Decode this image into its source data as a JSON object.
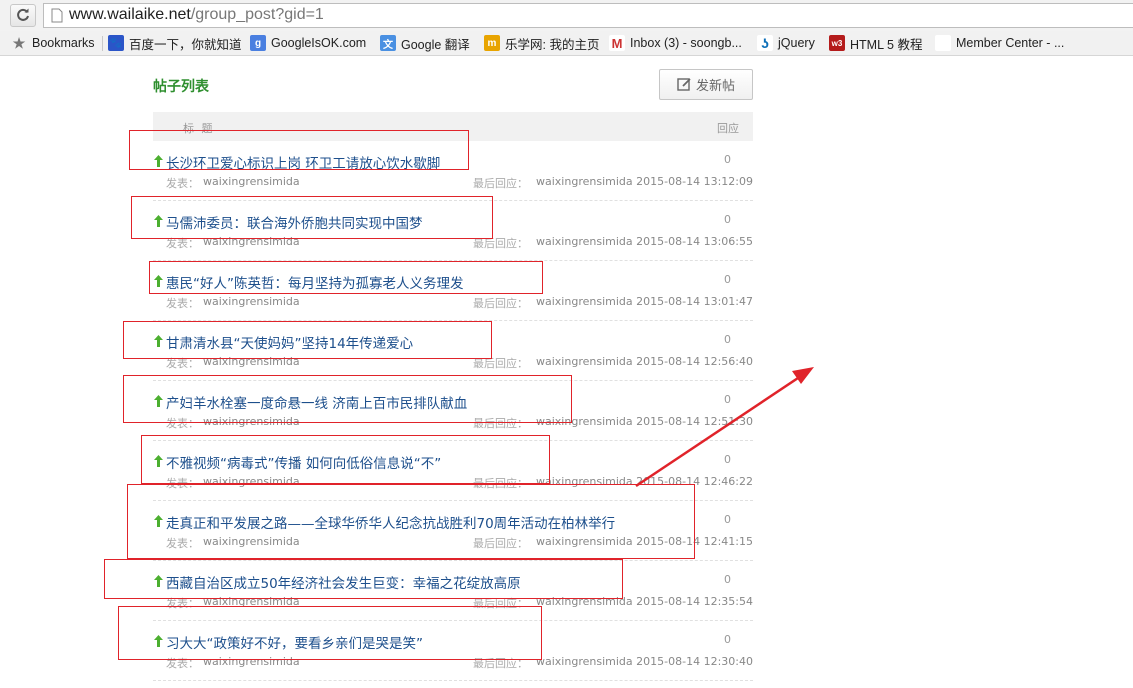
{
  "browser": {
    "url_domain": "www.wailaike.net",
    "url_path": "/group_post?gid=1",
    "bookmarks": [
      {
        "label": "Bookmarks",
        "icon": "star-icon"
      },
      {
        "label": "百度一下，你就知道",
        "icon": "baidu-paw-icon"
      },
      {
        "label": "GoogleIsOK.com",
        "icon": "google-g-icon"
      },
      {
        "label": "Google 翻译",
        "icon": "google-translate-icon"
      },
      {
        "label": "乐学网: 我的主页",
        "icon": "lexue-icon"
      },
      {
        "label": "Inbox (3) - soongb...",
        "icon": "gmail-icon"
      },
      {
        "label": "jQuery",
        "icon": "jquery-icon"
      },
      {
        "label": "HTML 5 教程",
        "icon": "w3school-icon"
      },
      {
        "label": "Member Center - ...",
        "icon": "apple-icon"
      }
    ]
  },
  "page": {
    "list_title": "帖子列表",
    "new_post_label": "发新帖",
    "header_title": "标 题",
    "header_replies": "回应",
    "author_prefix": "发表：",
    "last_reply_prefix": "最后回应：",
    "posts": [
      {
        "title": "长沙环卫爱心标识上岗 环卫工请放心饮水歇脚",
        "replies": "0",
        "author": "waixingrensimida",
        "last_user": "waixingrensimida",
        "last_time": "2015-08-14 13:12:09"
      },
      {
        "title": "马儒沛委员：联合海外侨胞共同实现中国梦",
        "replies": "0",
        "author": "waixingrensimida",
        "last_user": "waixingrensimida",
        "last_time": "2015-08-14 13:06:55"
      },
      {
        "title": "惠民“好人”陈英哲：每月坚持为孤寡老人义务理发",
        "replies": "0",
        "author": "waixingrensimida",
        "last_user": "waixingrensimida",
        "last_time": "2015-08-14 13:01:47"
      },
      {
        "title": "甘肃清水县“天使妈妈”坚持14年传递爱心",
        "replies": "0",
        "author": "waixingrensimida",
        "last_user": "waixingrensimida",
        "last_time": "2015-08-14 12:56:40"
      },
      {
        "title": "产妇羊水栓塞一度命悬一线 济南上百市民排队献血",
        "replies": "0",
        "author": "waixingrensimida",
        "last_user": "waixingrensimida",
        "last_time": "2015-08-14 12:51:30"
      },
      {
        "title": "不雅视频“病毒式”传播 如何向低俗信息说“不”",
        "replies": "0",
        "author": "waixingrensimida",
        "last_user": "waixingrensimida",
        "last_time": "2015-08-14 12:46:22"
      },
      {
        "title": "走真正和平发展之路——全球华侨华人纪念抗战胜利70周年活动在柏林举行",
        "replies": "0",
        "author": "waixingrensimida",
        "last_user": "waixingrensimida",
        "last_time": "2015-08-14 12:41:15"
      },
      {
        "title": "西藏自治区成立50年经济社会发生巨变：幸福之花绽放高原",
        "replies": "0",
        "author": "waixingrensimida",
        "last_user": "waixingrensimida",
        "last_time": "2015-08-14 12:35:54"
      },
      {
        "title": "习大大“政策好不好，要看乡亲们是哭是笑”",
        "replies": "0",
        "author": "waixingrensimida",
        "last_user": "waixingrensimida",
        "last_time": "2015-08-14 12:30:40"
      }
    ]
  },
  "colors": {
    "annotation_red": "#e0232a",
    "title_green": "#2f8f2f",
    "link_blue": "#1d4f8c",
    "up_arrow_green": "#4caf30"
  }
}
